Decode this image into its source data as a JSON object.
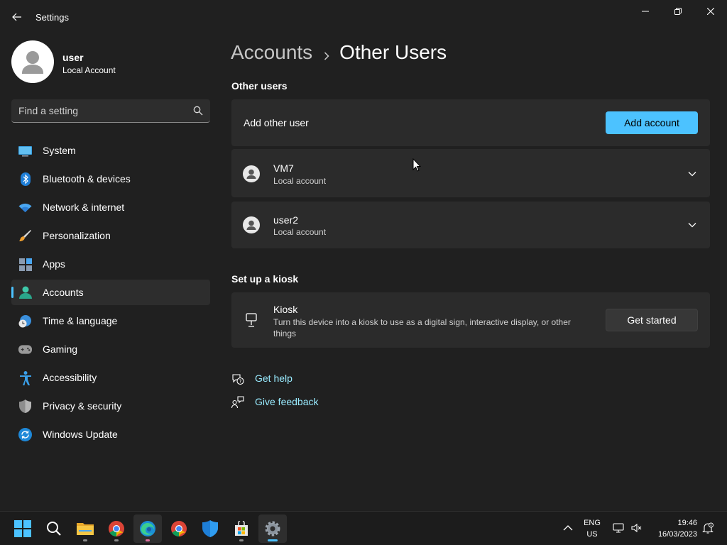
{
  "window": {
    "title": "Settings"
  },
  "profile": {
    "name": "user",
    "account_type": "Local Account"
  },
  "search": {
    "placeholder": "Find a setting"
  },
  "sidebar": {
    "items": [
      {
        "label": "System",
        "icon": "system-icon"
      },
      {
        "label": "Bluetooth & devices",
        "icon": "bluetooth-icon"
      },
      {
        "label": "Network & internet",
        "icon": "wifi-icon"
      },
      {
        "label": "Personalization",
        "icon": "brush-icon"
      },
      {
        "label": "Apps",
        "icon": "apps-icon"
      },
      {
        "label": "Accounts",
        "icon": "accounts-icon",
        "active": true
      },
      {
        "label": "Time & language",
        "icon": "clock-globe-icon"
      },
      {
        "label": "Gaming",
        "icon": "gamepad-icon"
      },
      {
        "label": "Accessibility",
        "icon": "accessibility-icon"
      },
      {
        "label": "Privacy & security",
        "icon": "shield-icon"
      },
      {
        "label": "Windows Update",
        "icon": "update-icon"
      }
    ]
  },
  "breadcrumb": {
    "parent": "Accounts",
    "current": "Other Users"
  },
  "other_users": {
    "heading": "Other users",
    "add_label": "Add other user",
    "add_button": "Add account",
    "users": [
      {
        "name": "VM7",
        "type": "Local account"
      },
      {
        "name": "user2",
        "type": "Local account"
      }
    ]
  },
  "kiosk": {
    "heading": "Set up a kiosk",
    "title": "Kiosk",
    "description": "Turn this device into a kiosk to use as a digital sign, interactive display, or other things",
    "button": "Get started"
  },
  "links": {
    "help": "Get help",
    "feedback": "Give feedback"
  },
  "taskbar": {
    "apps": [
      "start-icon",
      "search-icon",
      "file-explorer-icon",
      "chrome-icon",
      "edge-icon",
      "chrome-icon",
      "defender-icon",
      "store-icon",
      "settings-icon"
    ]
  },
  "tray": {
    "language": "ENG",
    "region": "US",
    "time": "19:46",
    "date": "16/03/2023"
  },
  "colors": {
    "accent": "#4cc2ff",
    "link": "#99ebff",
    "background": "#202020",
    "card": "#2b2b2b"
  }
}
